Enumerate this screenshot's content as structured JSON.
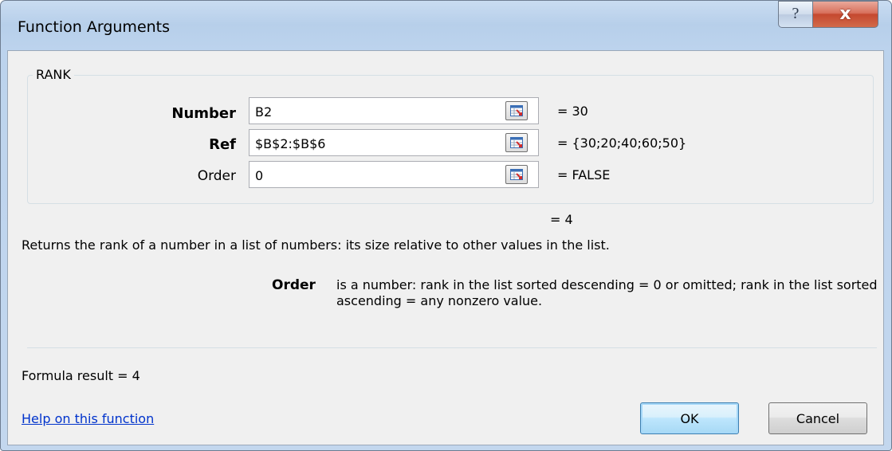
{
  "window": {
    "title": "Function Arguments"
  },
  "titlebar": {
    "help_glyph": "?",
    "close_glyph": "x"
  },
  "function": {
    "name": "RANK",
    "arguments": [
      {
        "label": "Number",
        "value": "B2",
        "result": "=  30"
      },
      {
        "label": "Ref",
        "value": "$B$2:$B$6",
        "result": "=  {30;20;40;60;50}"
      },
      {
        "label": "Order",
        "value": "0",
        "result": "=  FALSE"
      }
    ],
    "result": "=  4",
    "description": "Returns the rank of a number in a list of numbers: its size relative to other values in the list.",
    "arg_help_label": "Order",
    "arg_help_text": "is a number: rank in the list sorted descending = 0 or omitted; rank in the list sorted ascending = any nonzero value."
  },
  "footer": {
    "formula_result": "Formula result =   4",
    "help_link": "Help on this function",
    "ok_label": "OK",
    "cancel_label": "Cancel"
  },
  "icons": {
    "ref_button": "collapse-dialog-icon",
    "help": "help-icon",
    "close": "close-icon"
  },
  "colors": {
    "link": "#0033cc",
    "close_button": "#c5492f",
    "ok_button_border": "#3c7fb1"
  }
}
